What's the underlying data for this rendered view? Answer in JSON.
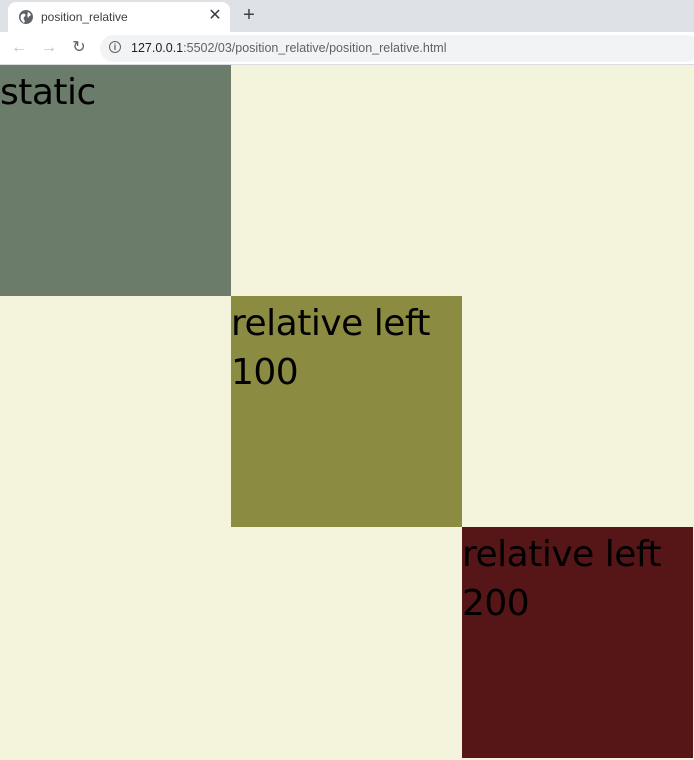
{
  "browser": {
    "tab": {
      "title": "position_relative",
      "favicon": "globe-icon",
      "close_glyph": "✕"
    },
    "new_tab_glyph": "+",
    "nav": {
      "back_glyph": "←",
      "forward_glyph": "→",
      "reload_glyph": "↻"
    },
    "address": {
      "host": "127.0.0.1",
      "rest": ":5502/03/position_relative/position_relative.html",
      "icon": "info-icon"
    }
  },
  "page": {
    "background": "#f4f3dc",
    "boxes": [
      {
        "label": "static",
        "color": "#6b7c6a"
      },
      {
        "label": "relative left 100",
        "color": "#8b8b41"
      },
      {
        "label": "relative left 200",
        "color": "#561517"
      }
    ]
  }
}
